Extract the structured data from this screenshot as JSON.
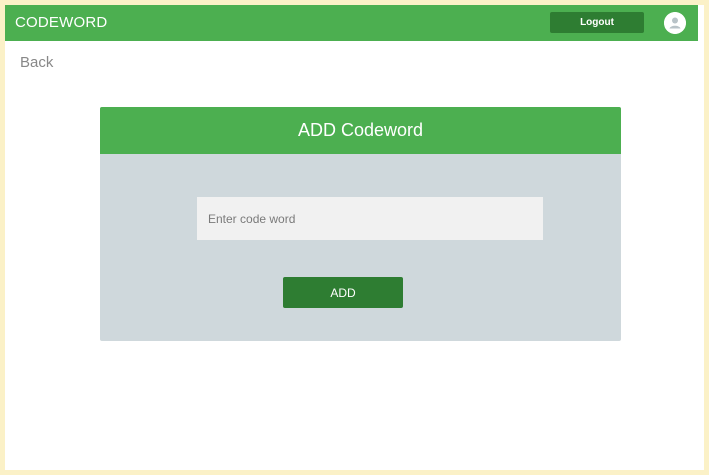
{
  "header": {
    "brand": "CODEWORD",
    "logout_label": "Logout",
    "avatar_icon": "user-icon"
  },
  "nav": {
    "back_label": "Back"
  },
  "card": {
    "title": "ADD Codeword",
    "input": {
      "value": "",
      "placeholder": "Enter code word"
    },
    "add_label": "ADD"
  },
  "colors": {
    "primary_green": "#4caf50",
    "dark_green": "#2e7d32",
    "card_body": "#cfd8dc",
    "frame_border": "#fbf1c7"
  }
}
